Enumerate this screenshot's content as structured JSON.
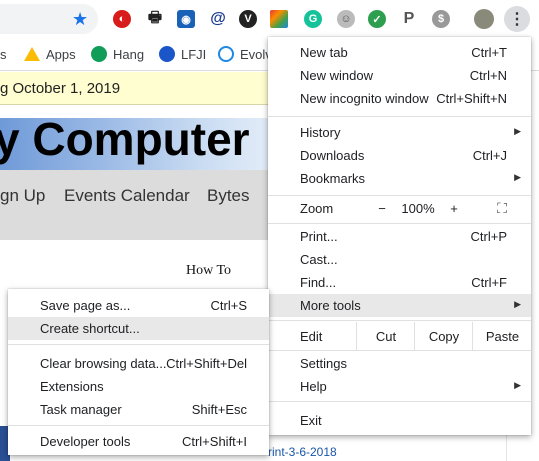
{
  "bookmarks": [
    "Apps",
    "Hang",
    "LFJI",
    "Evolv"
  ],
  "page": {
    "date_text": "g October 1, 2019",
    "banner_title": "y Computer",
    "nav": [
      "gn Up",
      "Events Calendar",
      "Bytes"
    ],
    "howto": "How To",
    "bottom_link": "rint-3-6-2018"
  },
  "chrome_menu": {
    "new_tab": {
      "label": "New tab",
      "shortcut": "Ctrl+T"
    },
    "new_window": {
      "label": "New window",
      "shortcut": "Ctrl+N"
    },
    "new_incognito": {
      "label": "New incognito window",
      "shortcut": "Ctrl+Shift+N"
    },
    "history": {
      "label": "History"
    },
    "downloads": {
      "label": "Downloads",
      "shortcut": "Ctrl+J"
    },
    "bookmarks": {
      "label": "Bookmarks"
    },
    "zoom": {
      "label": "Zoom",
      "minus": "−",
      "value": "100%",
      "plus": "+"
    },
    "print": {
      "label": "Print...",
      "shortcut": "Ctrl+P"
    },
    "cast": {
      "label": "Cast..."
    },
    "find": {
      "label": "Find...",
      "shortcut": "Ctrl+F"
    },
    "more_tools": {
      "label": "More tools"
    },
    "edit": {
      "label": "Edit",
      "cut": "Cut",
      "copy": "Copy",
      "paste": "Paste"
    },
    "settings": {
      "label": "Settings"
    },
    "help": {
      "label": "Help"
    },
    "exit": {
      "label": "Exit"
    }
  },
  "more_tools_menu": {
    "save_page": {
      "label": "Save page as...",
      "shortcut": "Ctrl+S"
    },
    "create_shortcut": {
      "label": "Create shortcut..."
    },
    "clear_data": {
      "label": "Clear browsing data...",
      "shortcut": "Ctrl+Shift+Del"
    },
    "extensions": {
      "label": "Extensions"
    },
    "task_manager": {
      "label": "Task manager",
      "shortcut": "Shift+Esc"
    },
    "dev_tools": {
      "label": "Developer tools",
      "shortcut": "Ctrl+Shift+I"
    }
  },
  "colors": {
    "accent": "#1a73e8",
    "hover": "#e8e8e8",
    "date_bg": "#fffed0"
  }
}
